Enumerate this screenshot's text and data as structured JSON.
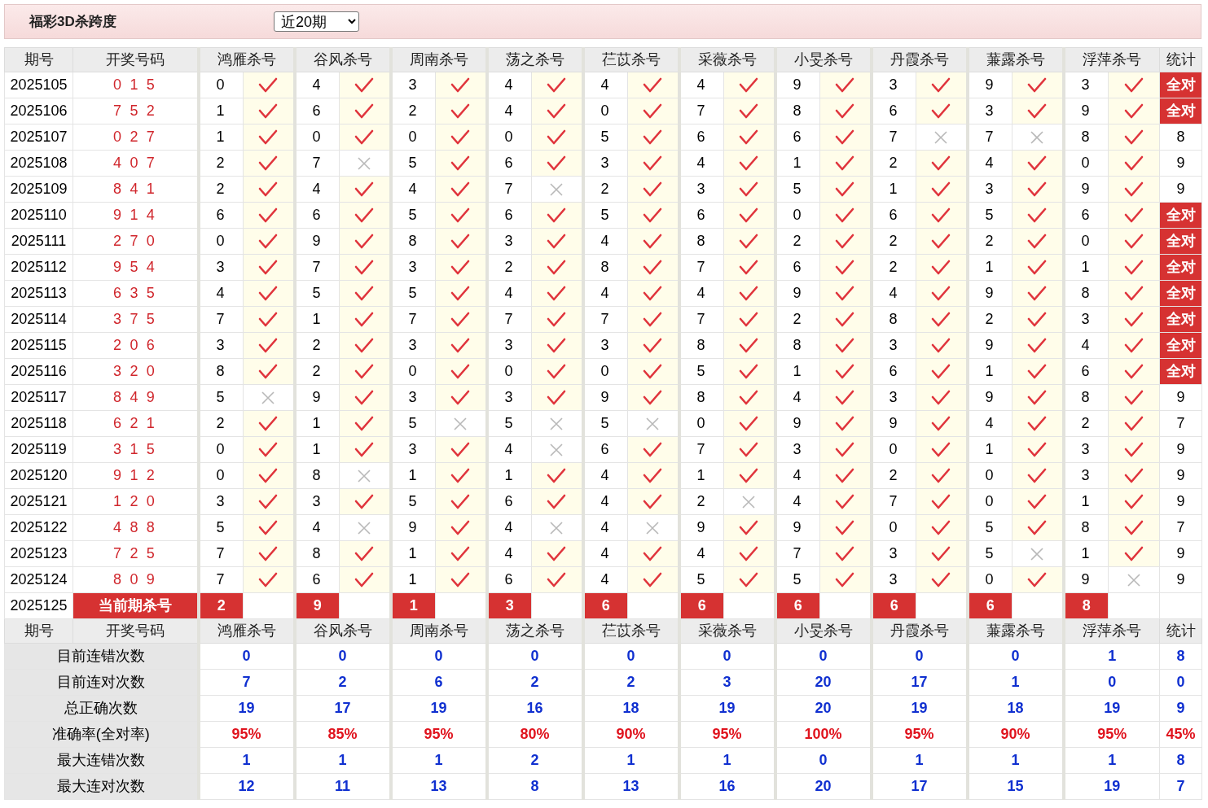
{
  "header": {
    "title": "福彩3D杀跨度",
    "period_select": {
      "value": "近20期"
    }
  },
  "table": {
    "columns": [
      "期号",
      "开奖号码",
      "鸿雁杀号",
      "谷风杀号",
      "周南杀号",
      "荡之杀号",
      "芢苡杀号",
      "采薇杀号",
      "小旻杀号",
      "丹霞杀号",
      "蒹露杀号",
      "浮萍杀号",
      "统计"
    ],
    "rows": [
      {
        "issue": "2025105",
        "draw": "0 1 5",
        "picks": [
          {
            "number": "0",
            "correct": true
          },
          {
            "number": "4",
            "correct": true
          },
          {
            "number": "3",
            "correct": true
          },
          {
            "number": "4",
            "correct": true
          },
          {
            "number": "4",
            "correct": true
          },
          {
            "number": "4",
            "correct": true
          },
          {
            "number": "9",
            "correct": true
          },
          {
            "number": "3",
            "correct": true
          },
          {
            "number": "9",
            "correct": true
          },
          {
            "number": "3",
            "correct": true
          }
        ],
        "stat": "全对",
        "all_correct": true
      },
      {
        "issue": "2025106",
        "draw": "7 5 2",
        "picks": [
          {
            "number": "1",
            "correct": true
          },
          {
            "number": "6",
            "correct": true
          },
          {
            "number": "2",
            "correct": true
          },
          {
            "number": "4",
            "correct": true
          },
          {
            "number": "0",
            "correct": true
          },
          {
            "number": "7",
            "correct": true
          },
          {
            "number": "8",
            "correct": true
          },
          {
            "number": "6",
            "correct": true
          },
          {
            "number": "3",
            "correct": true
          },
          {
            "number": "9",
            "correct": true
          }
        ],
        "stat": "全对",
        "all_correct": true
      },
      {
        "issue": "2025107",
        "draw": "0 2 7",
        "picks": [
          {
            "number": "1",
            "correct": true
          },
          {
            "number": "0",
            "correct": true
          },
          {
            "number": "0",
            "correct": true
          },
          {
            "number": "0",
            "correct": true
          },
          {
            "number": "5",
            "correct": true
          },
          {
            "number": "6",
            "correct": true
          },
          {
            "number": "6",
            "correct": true
          },
          {
            "number": "7",
            "correct": false
          },
          {
            "number": "7",
            "correct": false
          },
          {
            "number": "8",
            "correct": true
          }
        ],
        "stat": "8",
        "all_correct": false
      },
      {
        "issue": "2025108",
        "draw": "4 0 7",
        "picks": [
          {
            "number": "2",
            "correct": true
          },
          {
            "number": "7",
            "correct": false
          },
          {
            "number": "5",
            "correct": true
          },
          {
            "number": "6",
            "correct": true
          },
          {
            "number": "3",
            "correct": true
          },
          {
            "number": "4",
            "correct": true
          },
          {
            "number": "1",
            "correct": true
          },
          {
            "number": "2",
            "correct": true
          },
          {
            "number": "4",
            "correct": true
          },
          {
            "number": "0",
            "correct": true
          }
        ],
        "stat": "9",
        "all_correct": false
      },
      {
        "issue": "2025109",
        "draw": "8 4 1",
        "picks": [
          {
            "number": "2",
            "correct": true
          },
          {
            "number": "4",
            "correct": true
          },
          {
            "number": "4",
            "correct": true
          },
          {
            "number": "7",
            "correct": false
          },
          {
            "number": "2",
            "correct": true
          },
          {
            "number": "3",
            "correct": true
          },
          {
            "number": "5",
            "correct": true
          },
          {
            "number": "1",
            "correct": true
          },
          {
            "number": "3",
            "correct": true
          },
          {
            "number": "9",
            "correct": true
          }
        ],
        "stat": "9",
        "all_correct": false
      },
      {
        "issue": "2025110",
        "draw": "9 1 4",
        "picks": [
          {
            "number": "6",
            "correct": true
          },
          {
            "number": "6",
            "correct": true
          },
          {
            "number": "5",
            "correct": true
          },
          {
            "number": "6",
            "correct": true
          },
          {
            "number": "5",
            "correct": true
          },
          {
            "number": "6",
            "correct": true
          },
          {
            "number": "0",
            "correct": true
          },
          {
            "number": "6",
            "correct": true
          },
          {
            "number": "5",
            "correct": true
          },
          {
            "number": "6",
            "correct": true
          }
        ],
        "stat": "全对",
        "all_correct": true
      },
      {
        "issue": "2025111",
        "draw": "2 7 0",
        "picks": [
          {
            "number": "0",
            "correct": true
          },
          {
            "number": "9",
            "correct": true
          },
          {
            "number": "8",
            "correct": true
          },
          {
            "number": "3",
            "correct": true
          },
          {
            "number": "4",
            "correct": true
          },
          {
            "number": "8",
            "correct": true
          },
          {
            "number": "2",
            "correct": true
          },
          {
            "number": "2",
            "correct": true
          },
          {
            "number": "2",
            "correct": true
          },
          {
            "number": "0",
            "correct": true
          }
        ],
        "stat": "全对",
        "all_correct": true
      },
      {
        "issue": "2025112",
        "draw": "9 5 4",
        "picks": [
          {
            "number": "3",
            "correct": true
          },
          {
            "number": "7",
            "correct": true
          },
          {
            "number": "3",
            "correct": true
          },
          {
            "number": "2",
            "correct": true
          },
          {
            "number": "8",
            "correct": true
          },
          {
            "number": "7",
            "correct": true
          },
          {
            "number": "6",
            "correct": true
          },
          {
            "number": "2",
            "correct": true
          },
          {
            "number": "1",
            "correct": true
          },
          {
            "number": "1",
            "correct": true
          }
        ],
        "stat": "全对",
        "all_correct": true
      },
      {
        "issue": "2025113",
        "draw": "6 3 5",
        "picks": [
          {
            "number": "4",
            "correct": true
          },
          {
            "number": "5",
            "correct": true
          },
          {
            "number": "5",
            "correct": true
          },
          {
            "number": "4",
            "correct": true
          },
          {
            "number": "4",
            "correct": true
          },
          {
            "number": "4",
            "correct": true
          },
          {
            "number": "9",
            "correct": true
          },
          {
            "number": "4",
            "correct": true
          },
          {
            "number": "9",
            "correct": true
          },
          {
            "number": "8",
            "correct": true
          }
        ],
        "stat": "全对",
        "all_correct": true
      },
      {
        "issue": "2025114",
        "draw": "3 7 5",
        "picks": [
          {
            "number": "7",
            "correct": true
          },
          {
            "number": "1",
            "correct": true
          },
          {
            "number": "7",
            "correct": true
          },
          {
            "number": "7",
            "correct": true
          },
          {
            "number": "7",
            "correct": true
          },
          {
            "number": "7",
            "correct": true
          },
          {
            "number": "2",
            "correct": true
          },
          {
            "number": "8",
            "correct": true
          },
          {
            "number": "2",
            "correct": true
          },
          {
            "number": "3",
            "correct": true
          }
        ],
        "stat": "全对",
        "all_correct": true
      },
      {
        "issue": "2025115",
        "draw": "2 0 6",
        "picks": [
          {
            "number": "3",
            "correct": true
          },
          {
            "number": "2",
            "correct": true
          },
          {
            "number": "3",
            "correct": true
          },
          {
            "number": "3",
            "correct": true
          },
          {
            "number": "3",
            "correct": true
          },
          {
            "number": "8",
            "correct": true
          },
          {
            "number": "8",
            "correct": true
          },
          {
            "number": "3",
            "correct": true
          },
          {
            "number": "9",
            "correct": true
          },
          {
            "number": "4",
            "correct": true
          }
        ],
        "stat": "全对",
        "all_correct": true
      },
      {
        "issue": "2025116",
        "draw": "3 2 0",
        "picks": [
          {
            "number": "8",
            "correct": true
          },
          {
            "number": "2",
            "correct": true
          },
          {
            "number": "0",
            "correct": true
          },
          {
            "number": "0",
            "correct": true
          },
          {
            "number": "0",
            "correct": true
          },
          {
            "number": "5",
            "correct": true
          },
          {
            "number": "1",
            "correct": true
          },
          {
            "number": "6",
            "correct": true
          },
          {
            "number": "1",
            "correct": true
          },
          {
            "number": "6",
            "correct": true
          }
        ],
        "stat": "全对",
        "all_correct": true
      },
      {
        "issue": "2025117",
        "draw": "8 4 9",
        "picks": [
          {
            "number": "5",
            "correct": false
          },
          {
            "number": "9",
            "correct": true
          },
          {
            "number": "3",
            "correct": true
          },
          {
            "number": "3",
            "correct": true
          },
          {
            "number": "9",
            "correct": true
          },
          {
            "number": "8",
            "correct": true
          },
          {
            "number": "4",
            "correct": true
          },
          {
            "number": "3",
            "correct": true
          },
          {
            "number": "9",
            "correct": true
          },
          {
            "number": "8",
            "correct": true
          }
        ],
        "stat": "9",
        "all_correct": false
      },
      {
        "issue": "2025118",
        "draw": "6 2 1",
        "picks": [
          {
            "number": "2",
            "correct": true
          },
          {
            "number": "1",
            "correct": true
          },
          {
            "number": "5",
            "correct": false
          },
          {
            "number": "5",
            "correct": false
          },
          {
            "number": "5",
            "correct": false
          },
          {
            "number": "0",
            "correct": true
          },
          {
            "number": "9",
            "correct": true
          },
          {
            "number": "9",
            "correct": true
          },
          {
            "number": "4",
            "correct": true
          },
          {
            "number": "2",
            "correct": true
          }
        ],
        "stat": "7",
        "all_correct": false
      },
      {
        "issue": "2025119",
        "draw": "3 1 5",
        "picks": [
          {
            "number": "0",
            "correct": true
          },
          {
            "number": "1",
            "correct": true
          },
          {
            "number": "3",
            "correct": true
          },
          {
            "number": "4",
            "correct": false
          },
          {
            "number": "6",
            "correct": true
          },
          {
            "number": "7",
            "correct": true
          },
          {
            "number": "3",
            "correct": true
          },
          {
            "number": "0",
            "correct": true
          },
          {
            "number": "1",
            "correct": true
          },
          {
            "number": "3",
            "correct": true
          }
        ],
        "stat": "9",
        "all_correct": false
      },
      {
        "issue": "2025120",
        "draw": "9 1 2",
        "picks": [
          {
            "number": "0",
            "correct": true
          },
          {
            "number": "8",
            "correct": false
          },
          {
            "number": "1",
            "correct": true
          },
          {
            "number": "1",
            "correct": true
          },
          {
            "number": "4",
            "correct": true
          },
          {
            "number": "1",
            "correct": true
          },
          {
            "number": "4",
            "correct": true
          },
          {
            "number": "2",
            "correct": true
          },
          {
            "number": "0",
            "correct": true
          },
          {
            "number": "3",
            "correct": true
          }
        ],
        "stat": "9",
        "all_correct": false
      },
      {
        "issue": "2025121",
        "draw": "1 2 0",
        "picks": [
          {
            "number": "3",
            "correct": true
          },
          {
            "number": "3",
            "correct": true
          },
          {
            "number": "5",
            "correct": true
          },
          {
            "number": "6",
            "correct": true
          },
          {
            "number": "4",
            "correct": true
          },
          {
            "number": "2",
            "correct": false
          },
          {
            "number": "4",
            "correct": true
          },
          {
            "number": "7",
            "correct": true
          },
          {
            "number": "0",
            "correct": true
          },
          {
            "number": "1",
            "correct": true
          }
        ],
        "stat": "9",
        "all_correct": false
      },
      {
        "issue": "2025122",
        "draw": "4 8 8",
        "picks": [
          {
            "number": "5",
            "correct": true
          },
          {
            "number": "4",
            "correct": false
          },
          {
            "number": "9",
            "correct": true
          },
          {
            "number": "4",
            "correct": false
          },
          {
            "number": "4",
            "correct": false
          },
          {
            "number": "9",
            "correct": true
          },
          {
            "number": "9",
            "correct": true
          },
          {
            "number": "0",
            "correct": true
          },
          {
            "number": "5",
            "correct": true
          },
          {
            "number": "8",
            "correct": true
          }
        ],
        "stat": "7",
        "all_correct": false
      },
      {
        "issue": "2025123",
        "draw": "7 2 5",
        "picks": [
          {
            "number": "7",
            "correct": true
          },
          {
            "number": "8",
            "correct": true
          },
          {
            "number": "1",
            "correct": true
          },
          {
            "number": "4",
            "correct": true
          },
          {
            "number": "4",
            "correct": true
          },
          {
            "number": "4",
            "correct": true
          },
          {
            "number": "7",
            "correct": true
          },
          {
            "number": "3",
            "correct": true
          },
          {
            "number": "5",
            "correct": false
          },
          {
            "number": "1",
            "correct": true
          }
        ],
        "stat": "9",
        "all_correct": false
      },
      {
        "issue": "2025124",
        "draw": "8 0 9",
        "picks": [
          {
            "number": "7",
            "correct": true
          },
          {
            "number": "6",
            "correct": true
          },
          {
            "number": "1",
            "correct": true
          },
          {
            "number": "6",
            "correct": true
          },
          {
            "number": "4",
            "correct": true
          },
          {
            "number": "5",
            "correct": true
          },
          {
            "number": "5",
            "correct": true
          },
          {
            "number": "3",
            "correct": true
          },
          {
            "number": "0",
            "correct": true
          },
          {
            "number": "9",
            "correct": false
          }
        ],
        "stat": "9",
        "all_correct": false
      }
    ],
    "current": {
      "issue": "2025125",
      "label": "当前期杀号",
      "picks": [
        "2",
        "9",
        "1",
        "3",
        "6",
        "6",
        "6",
        "6",
        "6",
        "8"
      ]
    },
    "summary_columns": [
      "期号",
      "开奖号码",
      "鸿雁杀号",
      "谷风杀号",
      "周南杀号",
      "荡之杀号",
      "芢苡杀号",
      "采薇杀号",
      "小旻杀号",
      "丹霞杀号",
      "蒹露杀号",
      "浮萍杀号",
      "统计"
    ],
    "summary": [
      {
        "label": "目前连错次数",
        "kind": "count",
        "values": [
          "0",
          "0",
          "0",
          "0",
          "0",
          "0",
          "0",
          "0",
          "0",
          "1"
        ],
        "stat": "8"
      },
      {
        "label": "目前连对次数",
        "kind": "count",
        "values": [
          "7",
          "2",
          "6",
          "2",
          "2",
          "3",
          "20",
          "17",
          "1",
          "0"
        ],
        "stat": "0"
      },
      {
        "label": "总正确次数",
        "kind": "count",
        "values": [
          "19",
          "17",
          "19",
          "16",
          "18",
          "19",
          "20",
          "19",
          "18",
          "19"
        ],
        "stat": "9"
      },
      {
        "label": "准确率(全对率)",
        "kind": "rate",
        "values": [
          "95%",
          "85%",
          "95%",
          "80%",
          "90%",
          "95%",
          "100%",
          "95%",
          "90%",
          "95%"
        ],
        "stat": "45%"
      },
      {
        "label": "最大连错次数",
        "kind": "count",
        "values": [
          "1",
          "1",
          "1",
          "2",
          "1",
          "1",
          "0",
          "1",
          "1",
          "1"
        ],
        "stat": "8"
      },
      {
        "label": "最大连对次数",
        "kind": "count",
        "values": [
          "12",
          "11",
          "13",
          "8",
          "13",
          "16",
          "20",
          "17",
          "15",
          "19"
        ],
        "stat": "7"
      }
    ]
  }
}
